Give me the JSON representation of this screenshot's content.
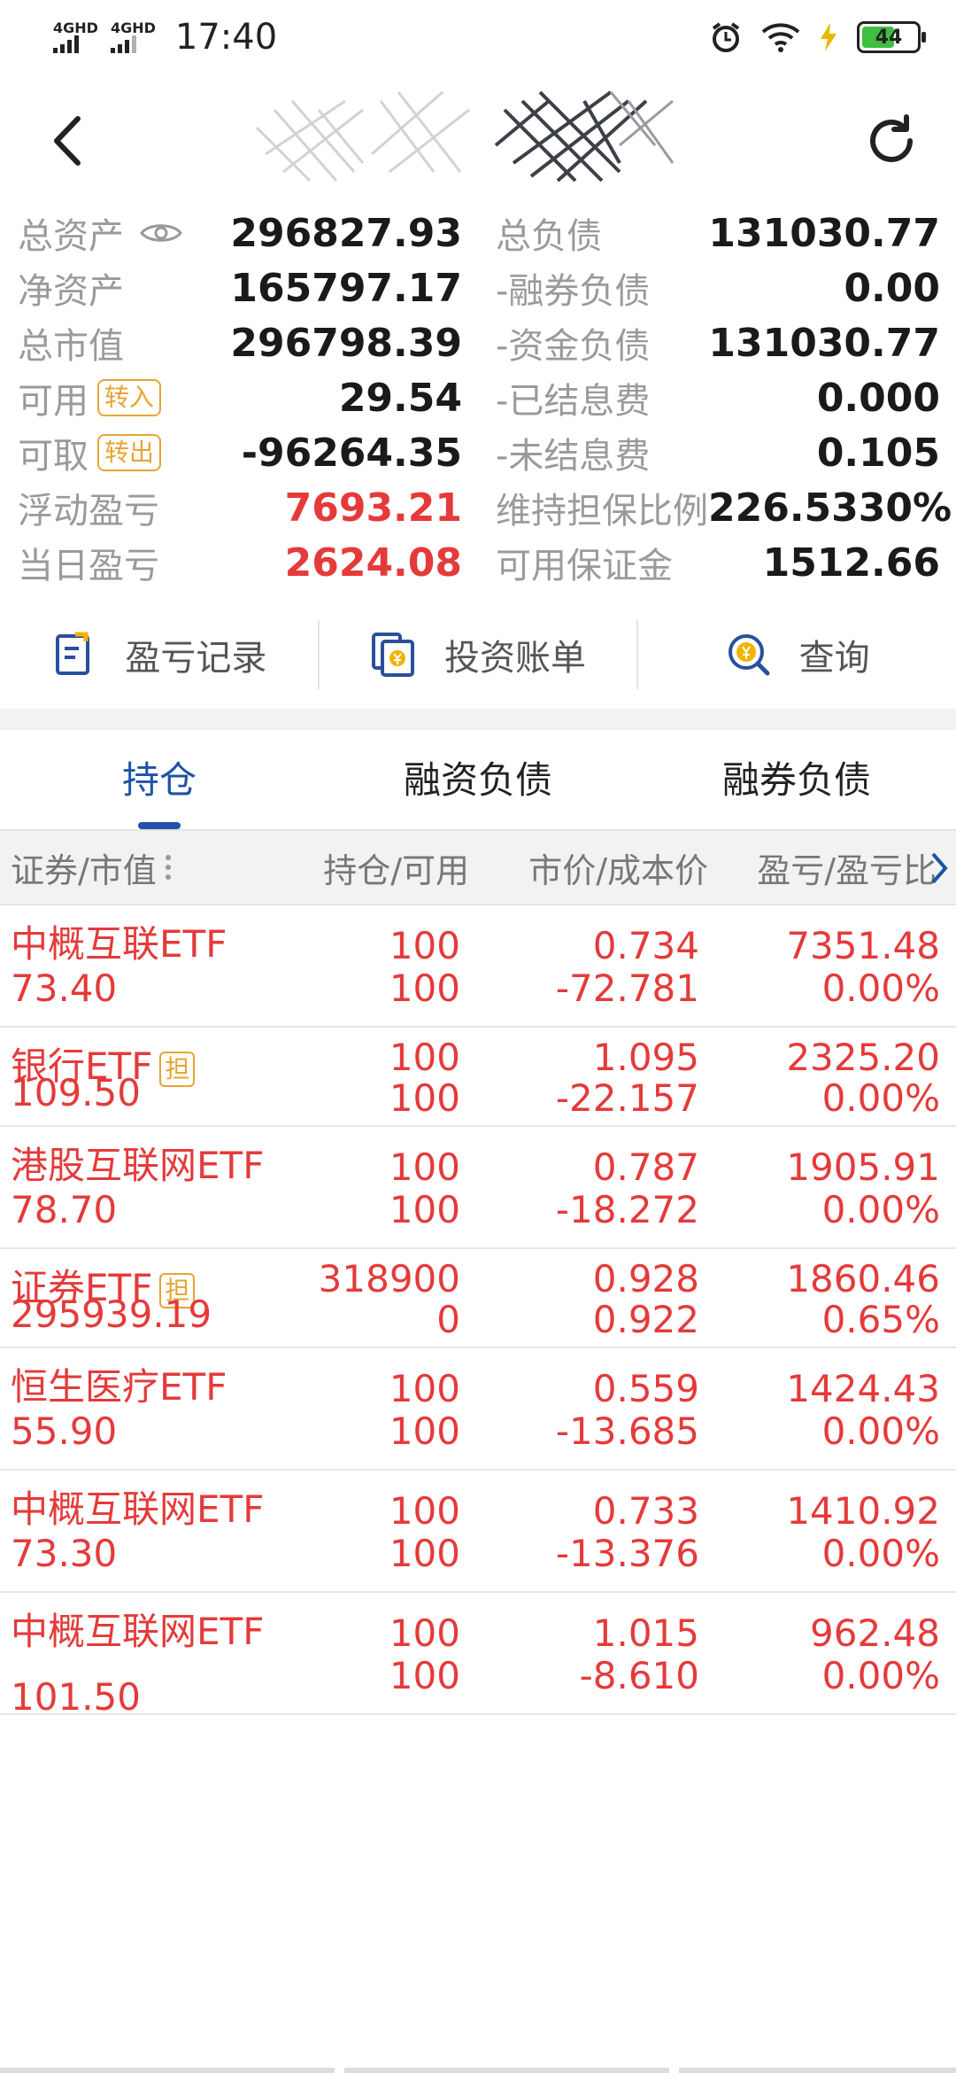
{
  "status_bar": {
    "signal1": "4GHD",
    "signal2": "4GHD",
    "time": "17:40",
    "battery": "44"
  },
  "summary": {
    "left": [
      {
        "label": "总资产",
        "value": "296827.93"
      },
      {
        "label": "净资产",
        "value": "165797.17"
      },
      {
        "label": "总市值",
        "value": "296798.39"
      },
      {
        "label": "可用",
        "tag": "转入",
        "value": "29.54"
      },
      {
        "label": "可取",
        "tag": "转出",
        "value": "-96264.35"
      },
      {
        "label": "浮动盈亏",
        "value": "7693.21"
      },
      {
        "label": "当日盈亏",
        "value": "2624.08"
      }
    ],
    "right": [
      {
        "label": "总负债",
        "value": "131030.77"
      },
      {
        "label": "-融券负债",
        "value": "0.00"
      },
      {
        "label": "-资金负债",
        "value": "131030.77"
      },
      {
        "label": "-已结息费",
        "value": "0.000"
      },
      {
        "label": "-未结息费",
        "value": "0.105"
      },
      {
        "label": "维持担保比例",
        "value": "226.5330%"
      },
      {
        "label": "可用保证金",
        "value": "1512.66"
      }
    ]
  },
  "actions": [
    "盈亏记录",
    "投资账单",
    "查询"
  ],
  "tabs": [
    "持仓",
    "融资负债",
    "融券负债"
  ],
  "table_header": [
    "证券/市值",
    "持仓/可用",
    "市价/成本价",
    "盈亏/盈亏比"
  ],
  "holdings": [
    {
      "name": "中概互联ETF",
      "market_value": "73.40",
      "qty": "100",
      "avail": "100",
      "price": "0.734",
      "cost": "-72.781",
      "pnl": "7351.48",
      "pnl_pct": "0.00%"
    },
    {
      "name": "银行ETF",
      "tag": "担",
      "market_value": "109.50",
      "qty": "100",
      "avail": "100",
      "price": "1.095",
      "cost": "-22.157",
      "pnl": "2325.20",
      "pnl_pct": "0.00%"
    },
    {
      "name": "港股互联网ETF",
      "market_value": "78.70",
      "qty": "100",
      "avail": "100",
      "price": "0.787",
      "cost": "-18.272",
      "pnl": "1905.91",
      "pnl_pct": "0.00%"
    },
    {
      "name": "证券ETF",
      "tag": "担",
      "market_value": "295939.19",
      "qty": "318900",
      "avail": "0",
      "price": "0.928",
      "cost": "0.922",
      "pnl": "1860.46",
      "pnl_pct": "0.65%"
    },
    {
      "name": "恒生医疗ETF",
      "market_value": "55.90",
      "qty": "100",
      "avail": "100",
      "price": "0.559",
      "cost": "-13.685",
      "pnl": "1424.43",
      "pnl_pct": "0.00%"
    },
    {
      "name": "中概互联网ETF",
      "market_value": "73.30",
      "qty": "100",
      "avail": "100",
      "price": "0.733",
      "cost": "-13.376",
      "pnl": "1410.92",
      "pnl_pct": "0.00%"
    },
    {
      "name": "中概互联网ETF",
      "market_value": "101.50",
      "qty": "100",
      "avail": "100",
      "price": "1.015",
      "cost": "-8.610",
      "pnl": "962.48",
      "pnl_pct": "0.00%"
    }
  ]
}
